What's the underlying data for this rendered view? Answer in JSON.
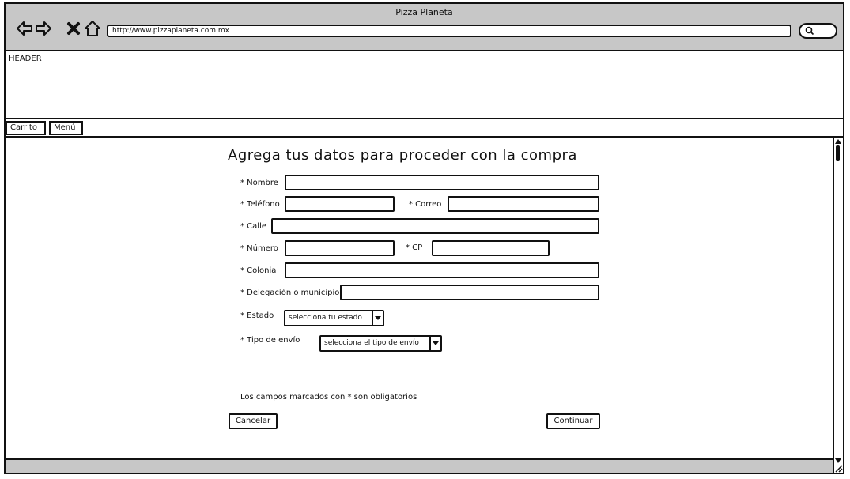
{
  "window": {
    "title": "Pizza Planeta"
  },
  "browser": {
    "url": "http://www.pizzaplaneta.com.mx",
    "icons": [
      "back-arrow-icon",
      "forward-arrow-icon",
      "close-x-icon",
      "home-icon",
      "search-icon"
    ]
  },
  "header": {
    "label": "HEADER"
  },
  "tabs": [
    {
      "label": "Carrito"
    },
    {
      "label": "Menú"
    }
  ],
  "form": {
    "title": "Agrega tus datos para proceder con la compra",
    "fields": {
      "nombre": "* Nombre",
      "telefono": "* Teléfono",
      "correo": "* Correo",
      "calle": "* Calle",
      "numero": "* Número",
      "cp": "* CP",
      "colonia": "* Colonia",
      "delegacion": "* Delegación o municipio",
      "estado": "* Estado",
      "tipo_envio": "* Tipo de envío"
    },
    "selects": {
      "estado": "selecciona tu estado",
      "tipo_envio": "selecciona el tipo de envío"
    },
    "note": "Los campos marcados con * son obligatorios",
    "buttons": {
      "cancel": "Cancelar",
      "continue": "Continuar"
    }
  }
}
